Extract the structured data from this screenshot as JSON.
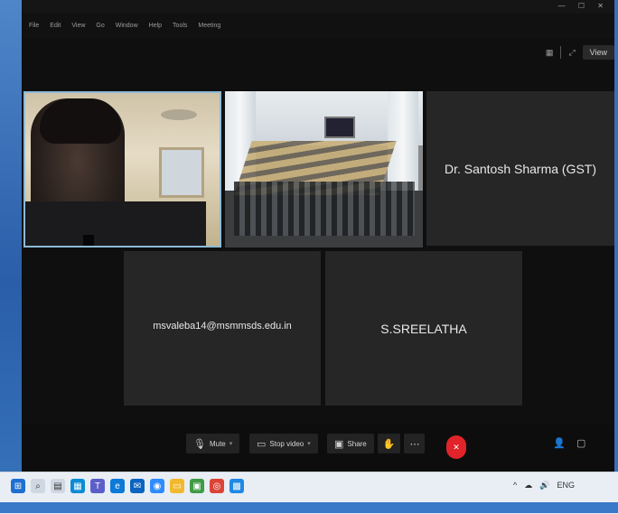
{
  "titlebar": {
    "title": "",
    "controls": "— ☐ ✕"
  },
  "menubar": {
    "items": [
      "File",
      "Edit",
      "View",
      "Go",
      "Window",
      "Help",
      "Tools",
      "Meeting"
    ]
  },
  "top_right": {
    "view_label": "View",
    "icons": [
      "grid-icon",
      "expand-icon"
    ]
  },
  "participants": {
    "self_name": "",
    "room_name": "",
    "name_tile": "Dr. Santosh Sharma (GST)",
    "email_tile": "msvaleba14@msmmsds.edu.in",
    "email_tile_sub": "",
    "sree_tile": "S.SREELATHA"
  },
  "toolbar": {
    "mute_label": "Mute",
    "video_label": "Stop video",
    "share_label": "Share",
    "more_icon": "⋯",
    "end_label": "✕"
  },
  "taskbar": {
    "icons": [
      "start",
      "search",
      "task-view",
      "explorer",
      "browser",
      "mail",
      "store",
      "folder",
      "teams",
      "chrome",
      "zoom",
      "app"
    ],
    "tray": [
      "^",
      "☁",
      "🔊",
      "ENG"
    ]
  },
  "colors": {
    "accent": "#e0242a",
    "tile_bg": "#262626",
    "active_border": "#8dbad6"
  }
}
